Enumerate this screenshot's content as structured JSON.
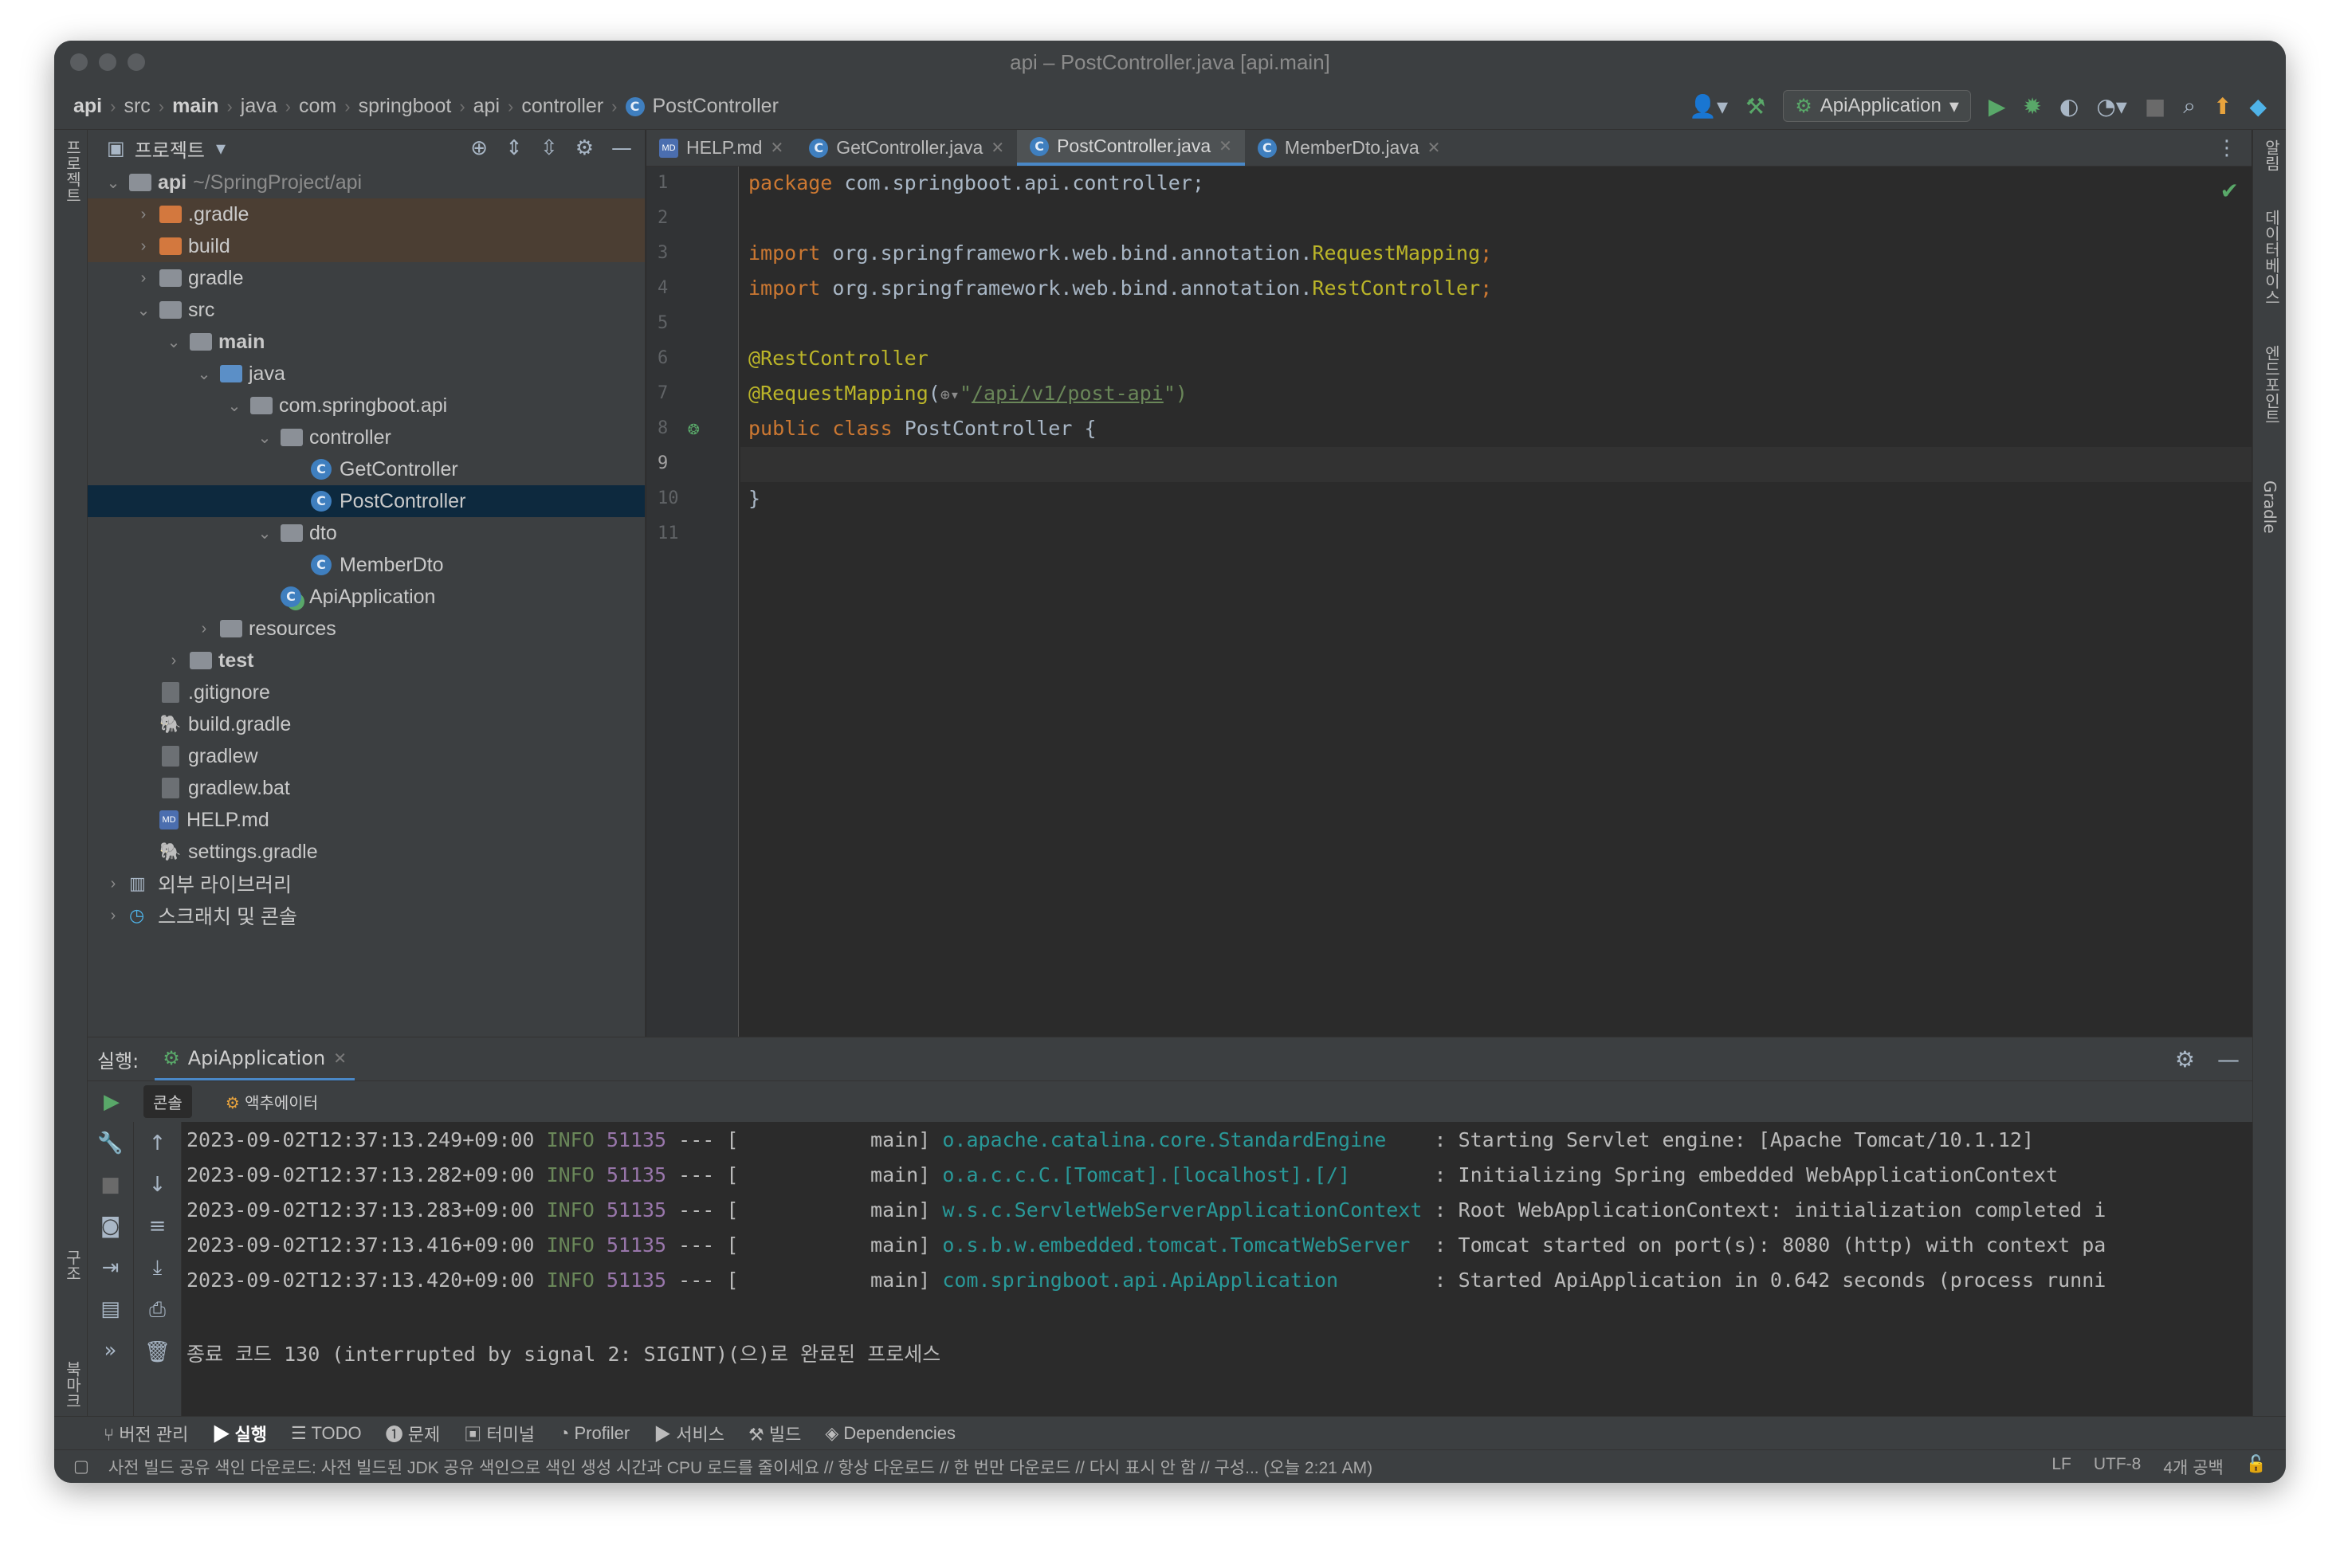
{
  "window": {
    "title": "api – PostController.java [api.main]"
  },
  "breadcrumbs": [
    "api",
    "src",
    "main",
    "java",
    "com",
    "springboot",
    "api",
    "controller",
    "PostController"
  ],
  "toolbar": {
    "run_config": "ApiApplication"
  },
  "project": {
    "header": "프로젝트",
    "tree": [
      {
        "label": "api",
        "suffix": "~/SpringProject/api",
        "depth": 0,
        "open": true,
        "icon": "module-folder-icon"
      },
      {
        "label": ".gradle",
        "depth": 1,
        "open": false,
        "icon": "excluded-folder-icon"
      },
      {
        "label": "build",
        "depth": 1,
        "open": false,
        "icon": "excluded-folder-icon"
      },
      {
        "label": "gradle",
        "depth": 1,
        "open": false,
        "icon": "folder-icon"
      },
      {
        "label": "src",
        "depth": 1,
        "open": true,
        "icon": "folder-icon"
      },
      {
        "label": "main",
        "depth": 2,
        "open": true,
        "icon": "folder-icon"
      },
      {
        "label": "java",
        "depth": 3,
        "open": true,
        "icon": "source-folder-icon"
      },
      {
        "label": "com.springboot.api",
        "depth": 4,
        "open": true,
        "icon": "package-icon"
      },
      {
        "label": "controller",
        "depth": 5,
        "open": true,
        "icon": "package-icon"
      },
      {
        "label": "GetController",
        "depth": 6,
        "icon": "class-icon"
      },
      {
        "label": "PostController",
        "depth": 6,
        "icon": "class-icon"
      },
      {
        "label": "dto",
        "depth": 5,
        "open": true,
        "icon": "package-icon"
      },
      {
        "label": "MemberDto",
        "depth": 6,
        "icon": "class-icon"
      },
      {
        "label": "ApiApplication",
        "depth": 5,
        "icon": "spring-app-icon"
      },
      {
        "label": "resources",
        "depth": 3,
        "open": false,
        "icon": "resources-folder-icon"
      },
      {
        "label": "test",
        "depth": 2,
        "open": false,
        "icon": "folder-icon"
      },
      {
        "label": ".gitignore",
        "depth": 1,
        "icon": "file-icon"
      },
      {
        "label": "build.gradle",
        "depth": 1,
        "icon": "gradle-icon"
      },
      {
        "label": "gradlew",
        "depth": 1,
        "icon": "file-icon"
      },
      {
        "label": "gradlew.bat",
        "depth": 1,
        "icon": "file-icon"
      },
      {
        "label": "HELP.md",
        "depth": 1,
        "icon": "markdown-icon"
      },
      {
        "label": "settings.gradle",
        "depth": 1,
        "icon": "gradle-icon"
      },
      {
        "label": "외부 라이브러리",
        "depth": 0,
        "open": false,
        "icon": "library-icon"
      },
      {
        "label": "스크래치 및 콘솔",
        "depth": 0,
        "open": false,
        "icon": "scratch-icon"
      }
    ]
  },
  "editor": {
    "tabs": [
      {
        "label": "HELP.md",
        "icon": "markdown-icon",
        "active": false
      },
      {
        "label": "GetController.java",
        "icon": "class-icon",
        "active": false
      },
      {
        "label": "PostController.java",
        "icon": "class-icon",
        "active": true
      },
      {
        "label": "MemberDto.java",
        "icon": "class-icon",
        "active": false
      }
    ],
    "line_numbers": [
      "1",
      "2",
      "3",
      "4",
      "5",
      "6",
      "7",
      "8",
      "9",
      "10",
      "11"
    ],
    "code": {
      "l1_kw": "package",
      "l1_rest": " com.springboot.api.controller;",
      "l3_kw": "import",
      "l3_rest": " org.springframework.web.bind.annotation.",
      "l3_cls": "RequestMapping",
      "l3_end": ";",
      "l4_kw": "import",
      "l4_rest": " org.springframework.web.bind.annotation.",
      "l4_cls": "RestController",
      "l4_end": ";",
      "l6_ann": "@RestController",
      "l7_ann": "@RequestMapping",
      "l7_open": "(",
      "l7_quote": "\"",
      "l7_str": "/api/v1/post-api",
      "l7_close": "\")",
      "l8_kw1": "public",
      "l8_kw2": "class",
      "l8_rest": " PostController {",
      "l10": "}"
    }
  },
  "run": {
    "label": "실행:",
    "tab": "ApiApplication",
    "subtabs": [
      "콘솔",
      "액추에이터"
    ],
    "logs": [
      {
        "ts": "2023-09-02T12:37:13.249+09:00",
        "level": "INFO",
        "pid": "51135",
        "sep": "--- [",
        "thread": "main]",
        "logger": "o.apache.catalina.core.StandardEngine",
        "msg": ": Starting Servlet engine: [Apache Tomcat/10.1.12]"
      },
      {
        "ts": "2023-09-02T12:37:13.282+09:00",
        "level": "INFO",
        "pid": "51135",
        "sep": "--- [",
        "thread": "main]",
        "logger": "o.a.c.c.C.[Tomcat].[localhost].[/]",
        "msg": ": Initializing Spring embedded WebApplicationContext"
      },
      {
        "ts": "2023-09-02T12:37:13.283+09:00",
        "level": "INFO",
        "pid": "51135",
        "sep": "--- [",
        "thread": "main]",
        "logger": "w.s.c.ServletWebServerApplicationContext",
        "msg": ": Root WebApplicationContext: initialization completed i"
      },
      {
        "ts": "2023-09-02T12:37:13.416+09:00",
        "level": "INFO",
        "pid": "51135",
        "sep": "--- [",
        "thread": "main]",
        "logger": "o.s.b.w.embedded.tomcat.TomcatWebServer",
        "msg": ": Tomcat started on port(s): 8080 (http) with context pa"
      },
      {
        "ts": "2023-09-02T12:37:13.420+09:00",
        "level": "INFO",
        "pid": "51135",
        "sep": "--- [",
        "thread": "main]",
        "logger": "com.springboot.api.ApiApplication",
        "msg": ": Started ApiApplication in 0.642 seconds (process runni"
      }
    ],
    "exit_message": "종료 코드 130 (interrupted by signal 2: SIGINT)(으)로 완료된 프로세스"
  },
  "tool_windows": [
    "버전 관리",
    "실행",
    "TODO",
    "문제",
    "터미널",
    "Profiler",
    "서비스",
    "빌드",
    "Dependencies"
  ],
  "left_strip": {
    "project": "프로젝트",
    "structure": "구조",
    "bookmarks": "북마크"
  },
  "right_strip": {
    "notifications": "알림",
    "database": "데이터베이스",
    "endpoints": "엔드포인트",
    "gradle": "Gradle"
  },
  "status": {
    "message": "사전 빌드 공유 색인 다운로드: 사전 빌드된 JDK 공유 색인으로 색인 생성 시간과 CPU 로드를 줄이세요 // 항상 다운로드 // 한 번만 다운로드 // 다시 표시 안 함 // 구성... (오늘 2:21 AM)",
    "line_sep": "LF",
    "encoding": "UTF-8",
    "indent": "4개 공백"
  },
  "colors": {
    "accent": "#4a88c7",
    "selection": "#0d293e",
    "keyword": "#cc7832",
    "annotation": "#bbb529",
    "string": "#6a8759",
    "logger": "#299999"
  }
}
